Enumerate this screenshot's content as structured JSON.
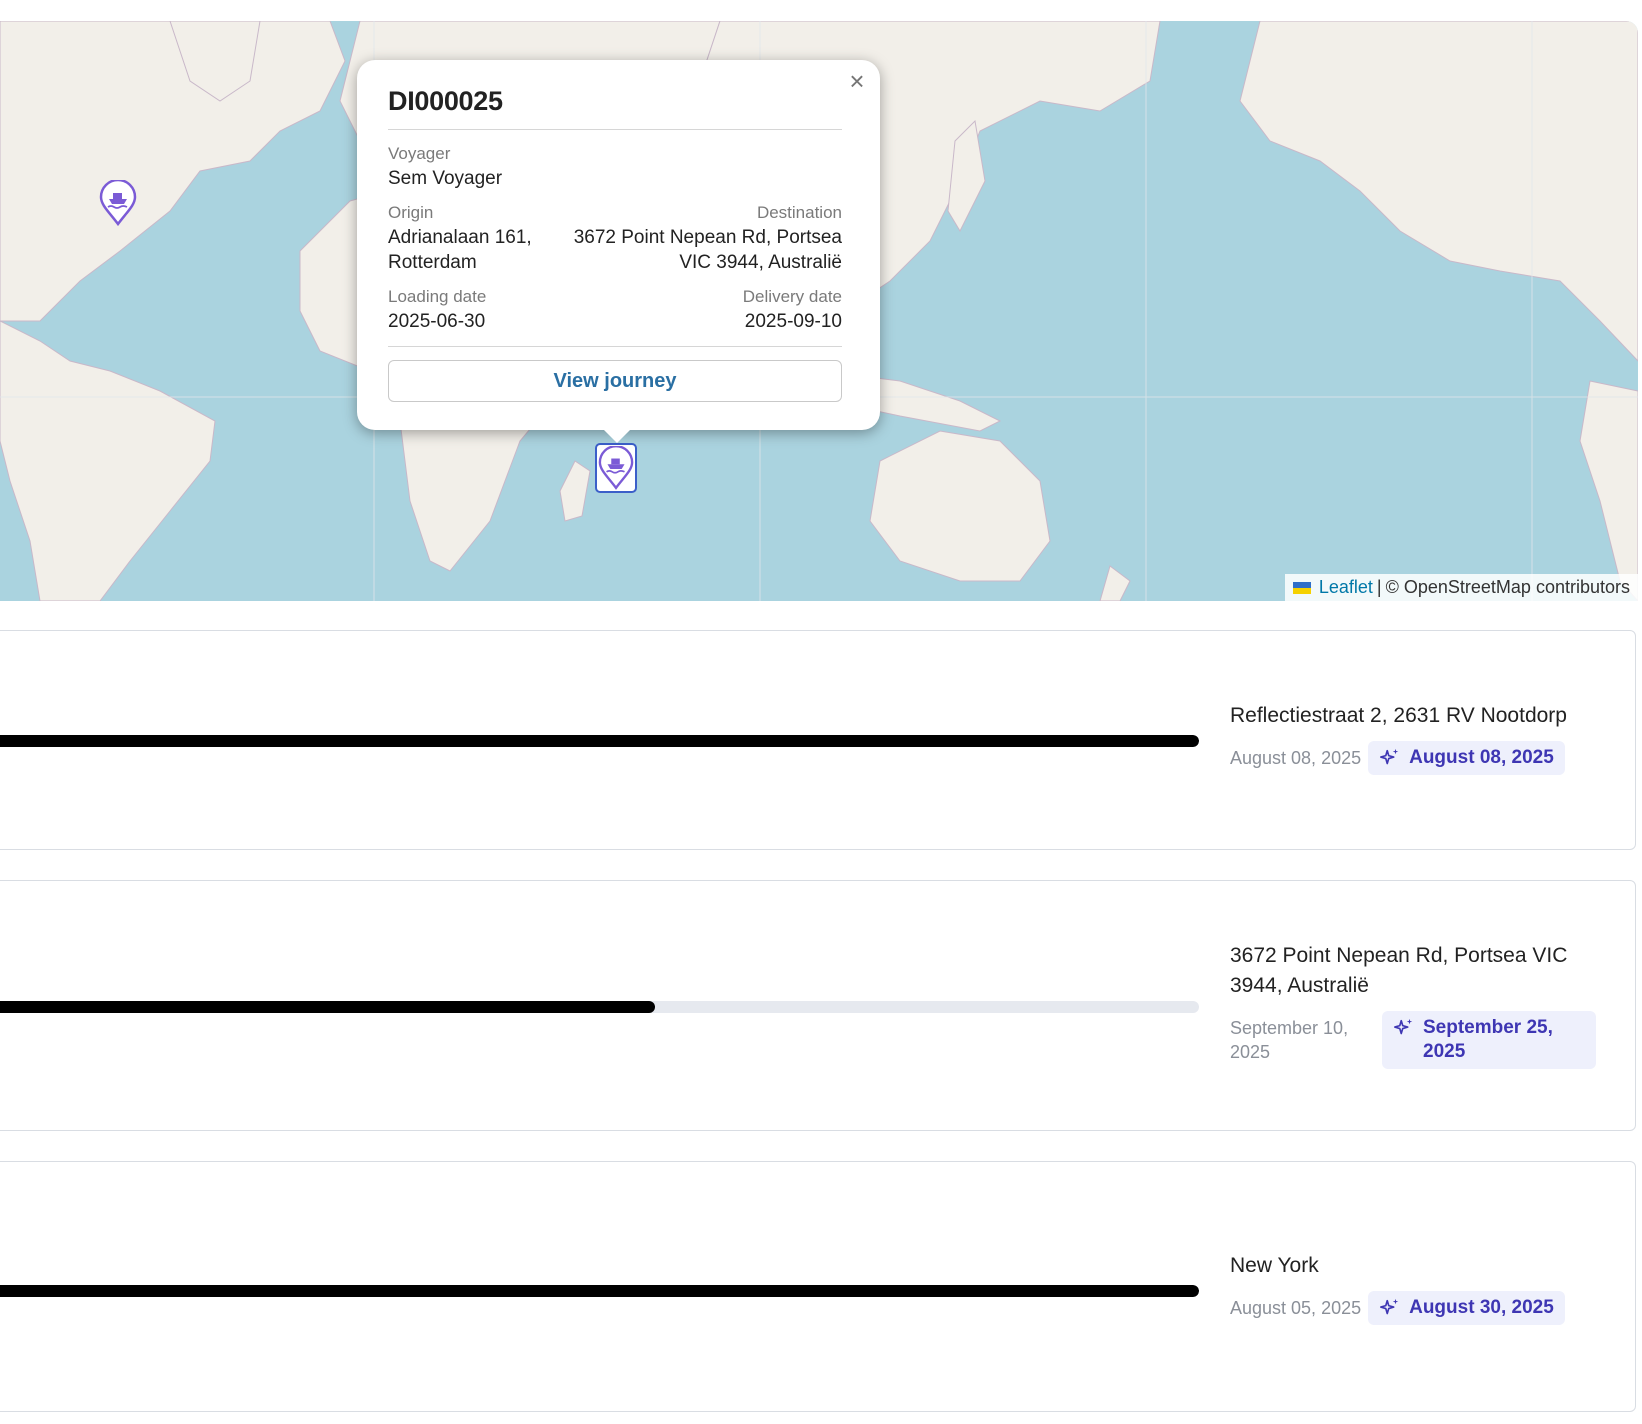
{
  "map": {
    "attribution": {
      "leaflet_link": "Leaflet",
      "separator": "|",
      "osm_text": "© OpenStreetMap contributors"
    },
    "markers": [
      {
        "icon": "ship-location-marker-icon",
        "selected": false
      },
      {
        "icon": "ship-location-marker-icon",
        "selected": true
      }
    ],
    "colors": {
      "water": "#aad3df",
      "land": "#f2efe9",
      "marker": "#7b5bd6"
    }
  },
  "popup": {
    "title": "DI000025",
    "close_label": "×",
    "voyager_label": "Voyager",
    "voyager_value": "Sem Voyager",
    "origin_label": "Origin",
    "origin_value": "Adrianalaan 161, Rotterdam",
    "destination_label": "Destination",
    "destination_value": "3672 Point Nepean Rd, Portsea VIC 3944, Australië",
    "loading_label": "Loading date",
    "loading_value": "2025-06-30",
    "delivery_label": "Delivery date",
    "delivery_value": "2025-09-10",
    "button_label": "View journey"
  },
  "journeys": [
    {
      "destination": "Reflectiestraat 2, 2631 RV Nootdorp",
      "planned_date": "August 08, 2025",
      "predicted_date": "August 08, 2025",
      "progress": 1.0
    },
    {
      "destination": "3672 Point Nepean Rd, Portsea VIC 3944, Australië",
      "planned_date": "September 10, 2025",
      "predicted_date": "September 25, 2025",
      "progress": 0.55
    },
    {
      "destination": "New York",
      "planned_date": "August 05, 2025",
      "predicted_date": "August 30, 2025",
      "progress": 1.0
    }
  ]
}
